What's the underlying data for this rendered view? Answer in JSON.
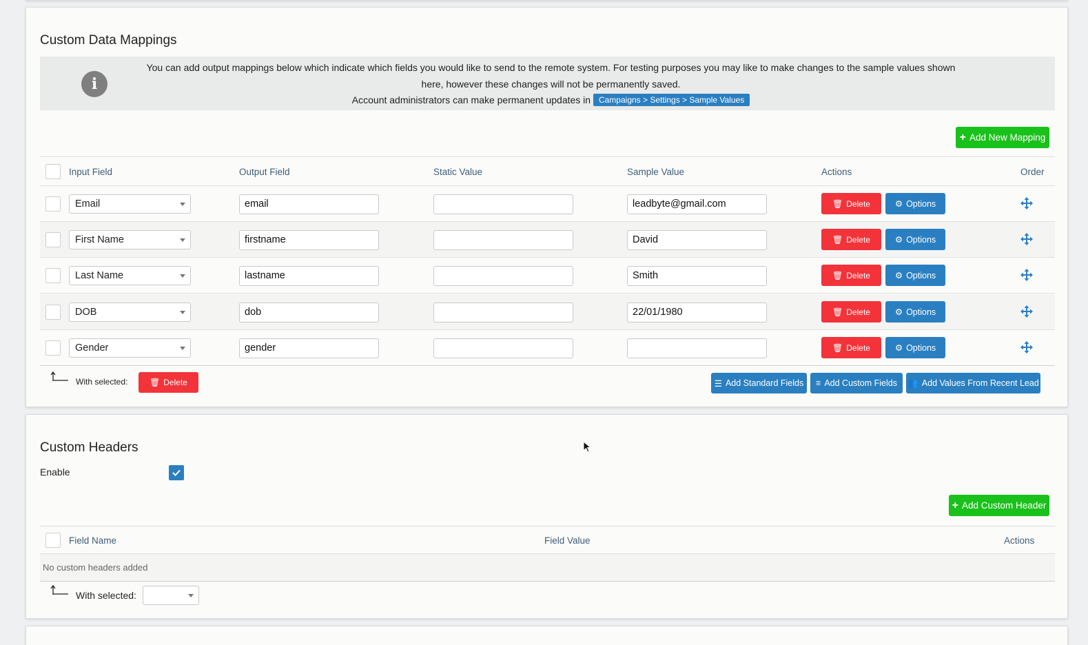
{
  "mappings": {
    "title": "Custom Data Mappings",
    "info": {
      "line1": "You can add output mappings below which indicate which fields you would like to send to the remote system. For testing purposes you may like to make changes to the sample values shown here, however these changes will not be permanently saved.",
      "line2_prefix": "Account administrators can make permanent updates in",
      "link": "Campaigns > Settings > Sample Values"
    },
    "add_button": "Add New Mapping",
    "columns": {
      "input": "Input Field",
      "output": "Output Field",
      "static": "Static Value",
      "sample": "Sample Value",
      "actions": "Actions",
      "order": "Order"
    },
    "rows": [
      {
        "input": "Email",
        "output": "email",
        "static": "",
        "sample": "leadbyte@gmail.com"
      },
      {
        "input": "First Name",
        "output": "firstname",
        "static": "",
        "sample": "David"
      },
      {
        "input": "Last Name",
        "output": "lastname",
        "static": "",
        "sample": "Smith"
      },
      {
        "input": "DOB",
        "output": "dob",
        "static": "",
        "sample": "22/01/1980"
      },
      {
        "input": "Gender",
        "output": "gender",
        "static": "",
        "sample": ""
      }
    ],
    "delete_label": "Delete",
    "options_label": "Options",
    "with_selected": "With selected:",
    "bulk_delete": "Delete",
    "add_standard": "Add Standard Fields",
    "add_custom": "Add Custom Fields",
    "add_recent": "Add Values From Recent Lead"
  },
  "headers": {
    "title": "Custom Headers",
    "enable_label": "Enable",
    "enabled": true,
    "add_button": "Add Custom Header",
    "columns": {
      "name": "Field Name",
      "value": "Field Value",
      "actions": "Actions"
    },
    "empty": "No custom headers added",
    "with_selected": "With selected:",
    "bulk_select_value": ""
  },
  "colors": {
    "green": "#19c11a",
    "red": "#f2333a",
    "blue": "#2a7fc1",
    "header_text": "#3f5d79"
  }
}
